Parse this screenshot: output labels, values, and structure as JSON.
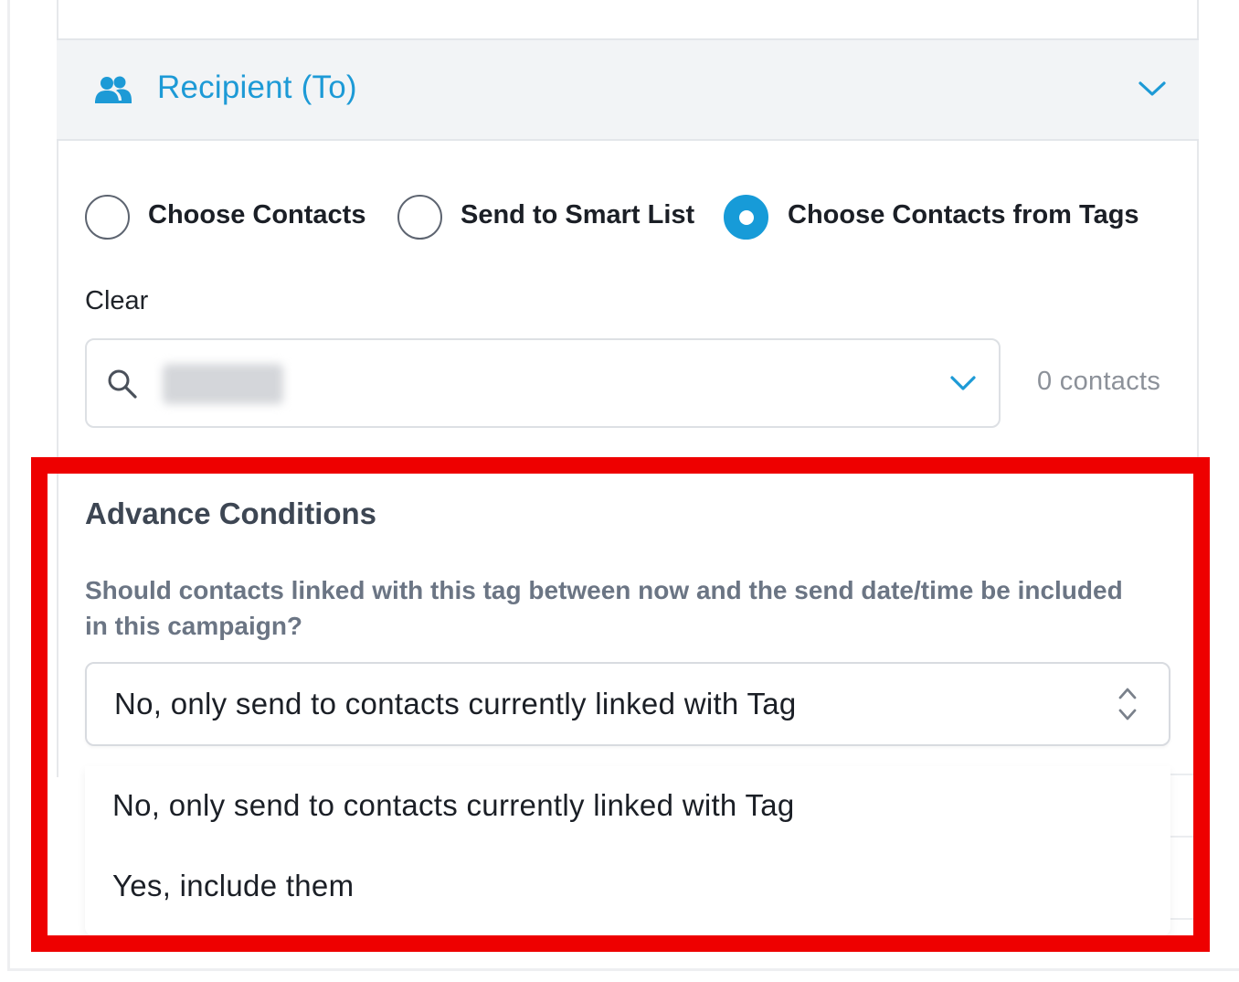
{
  "recipient": {
    "title": "Recipient (To)",
    "icon": "users-icon",
    "accent": "#1d9ad6"
  },
  "recipient_options": [
    {
      "label": "Choose Contacts",
      "checked": false
    },
    {
      "label": "Send to Smart List",
      "checked": false
    },
    {
      "label": "Choose Contacts from Tags",
      "checked": true
    }
  ],
  "clear_label": "Clear",
  "tag_select": {
    "icon": "search-icon",
    "chevron": "chevron-down-icon"
  },
  "contacts_count": "0 contacts",
  "advance_conditions": {
    "title": "Advance Conditions",
    "description": "Should contacts linked with this tag between now and the send date/time be included in this campaign?",
    "selected_value": "No, only send to contacts currently linked with Tag",
    "options": [
      "No, only send to contacts currently linked with Tag",
      "Yes, include them"
    ]
  },
  "highlight_color": "#ee0000"
}
